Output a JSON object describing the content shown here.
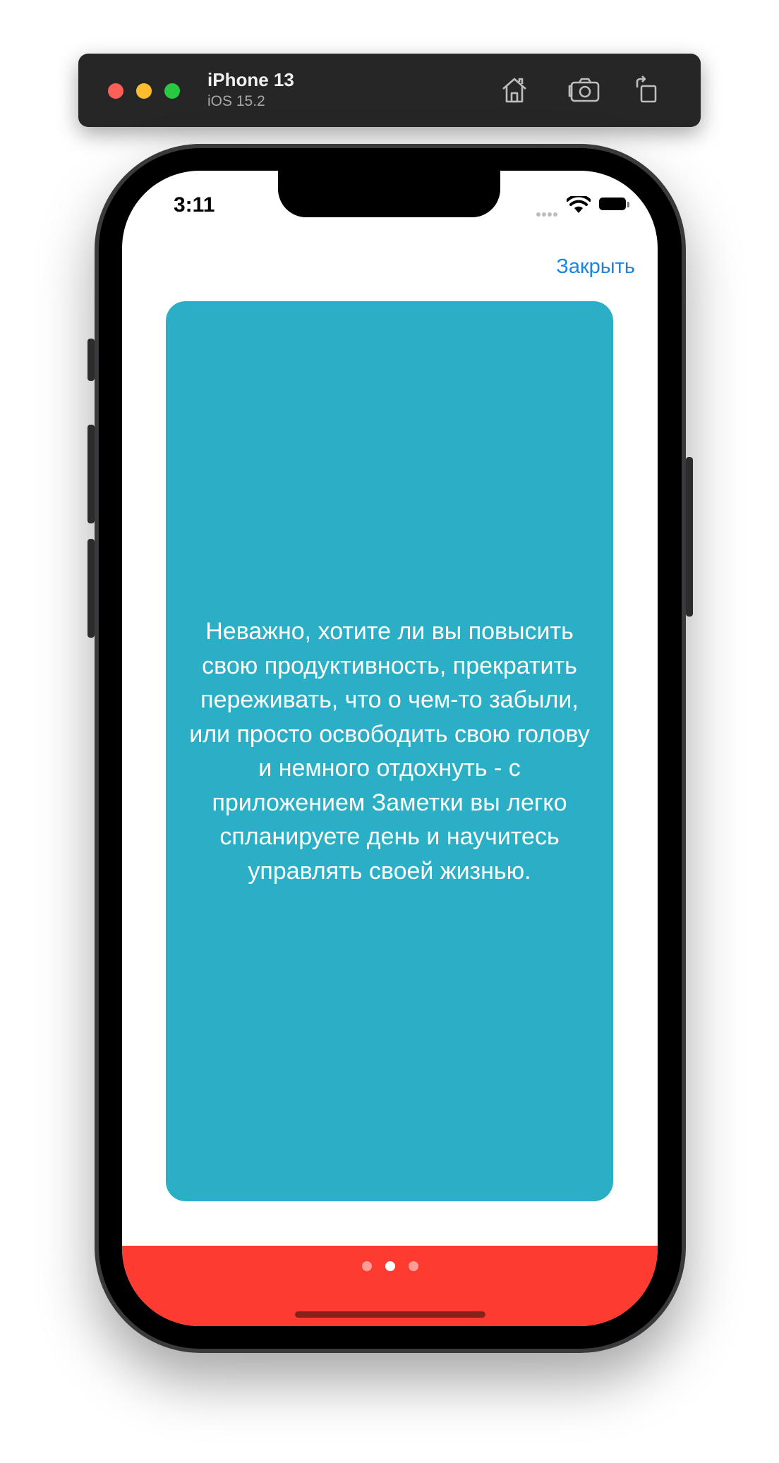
{
  "simulator": {
    "device_name": "iPhone 13",
    "os_version": "iOS 15.2",
    "icons": [
      "home-icon",
      "screenshot-icon",
      "rotate-icon"
    ]
  },
  "status_bar": {
    "time": "3:11"
  },
  "nav": {
    "close_label": "Закрыть"
  },
  "onboarding": {
    "text": "Неважно, хотите ли вы повысить свою продуктивность, прекратить переживать, что о чем-то забыли, или просто освободить свою голову и немного отдохнуть - с приложением Заметки вы легко спланируете день и научитесь управлять своей жизнью.",
    "card_color": "#2aafc6",
    "footer_color": "#fe3b30",
    "page_count": 3,
    "current_page": 2
  },
  "colors": {
    "accent": "#1a84e6"
  }
}
